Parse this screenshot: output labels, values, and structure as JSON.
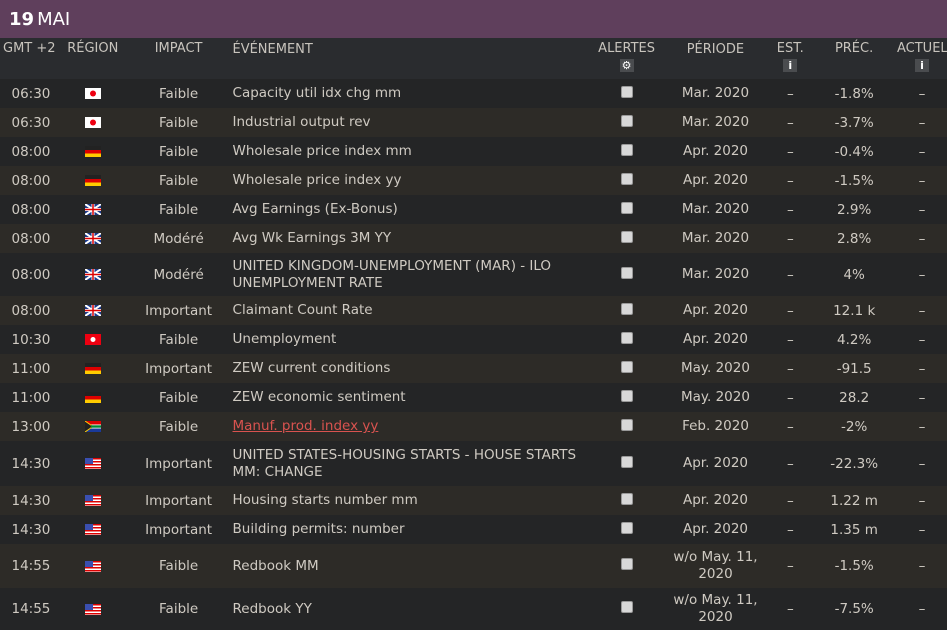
{
  "header": {
    "day": "19",
    "month": "MAI"
  },
  "columns": {
    "time": "GMT +2",
    "region": "RÉGION",
    "impact": "IMPACT",
    "event": "ÉVÉNEMENT",
    "alerts": "ALERTES",
    "period": "PÉRIODE",
    "est": "EST.",
    "prev": "PRÉC.",
    "actual": "ACTUEL",
    "info": "i",
    "gear": "⚙"
  },
  "rows": [
    {
      "time": "06:30",
      "region": "jp",
      "impact": "Faible",
      "event": "Capacity util idx chg mm",
      "period": "Mar. 2020",
      "est": "–",
      "prev": "-1.8%",
      "actual": "–"
    },
    {
      "time": "06:30",
      "region": "jp",
      "impact": "Faible",
      "event": "Industrial output rev",
      "period": "Mar. 2020",
      "est": "–",
      "prev": "-3.7%",
      "actual": "–"
    },
    {
      "time": "08:00",
      "region": "de",
      "impact": "Faible",
      "event": "Wholesale price index mm",
      "period": "Apr. 2020",
      "est": "–",
      "prev": "-0.4%",
      "actual": "–"
    },
    {
      "time": "08:00",
      "region": "de",
      "impact": "Faible",
      "event": "Wholesale price index yy",
      "period": "Apr. 2020",
      "est": "–",
      "prev": "-1.5%",
      "actual": "–"
    },
    {
      "time": "08:00",
      "region": "gb",
      "impact": "Faible",
      "event": "Avg Earnings (Ex-Bonus)",
      "period": "Mar. 2020",
      "est": "–",
      "prev": "2.9%",
      "actual": "–"
    },
    {
      "time": "08:00",
      "region": "gb",
      "impact": "Modéré",
      "event": "Avg Wk Earnings 3M YY",
      "period": "Mar. 2020",
      "est": "–",
      "prev": "2.8%",
      "actual": "–"
    },
    {
      "time": "08:00",
      "region": "gb",
      "impact": "Modéré",
      "event": "UNITED KINGDOM-UNEMPLOYMENT (MAR) - ILO UNEMPLOYMENT RATE",
      "period": "Mar. 2020",
      "est": "–",
      "prev": "4%",
      "actual": "–"
    },
    {
      "time": "08:00",
      "region": "gb",
      "impact": "Important",
      "event": "Claimant Count Rate",
      "period": "Apr. 2020",
      "est": "–",
      "prev": "12.1 k",
      "actual": "–"
    },
    {
      "time": "10:30",
      "region": "hk",
      "impact": "Faible",
      "event": "Unemployment",
      "period": "Apr. 2020",
      "est": "–",
      "prev": "4.2%",
      "actual": "–"
    },
    {
      "time": "11:00",
      "region": "de",
      "impact": "Important",
      "event": "ZEW current conditions",
      "period": "May. 2020",
      "est": "–",
      "prev": "-91.5",
      "actual": "–"
    },
    {
      "time": "11:00",
      "region": "de",
      "impact": "Faible",
      "event": "ZEW economic sentiment",
      "period": "May. 2020",
      "est": "–",
      "prev": "28.2",
      "actual": "–"
    },
    {
      "time": "13:00",
      "region": "za",
      "impact": "Faible",
      "event": "Manuf. prod. index yy",
      "link": true,
      "period": "Feb. 2020",
      "est": "–",
      "prev": "-2%",
      "actual": "–"
    },
    {
      "time": "14:30",
      "region": "us",
      "impact": "Important",
      "event": "UNITED STATES-HOUSING STARTS - HOUSE STARTS MM: CHANGE",
      "period": "Apr. 2020",
      "est": "–",
      "prev": "-22.3%",
      "actual": "–"
    },
    {
      "time": "14:30",
      "region": "us",
      "impact": "Important",
      "event": "Housing starts number mm",
      "period": "Apr. 2020",
      "est": "–",
      "prev": "1.22 m",
      "actual": "–"
    },
    {
      "time": "14:30",
      "region": "us",
      "impact": "Important",
      "event": "Building permits: number",
      "period": "Apr. 2020",
      "est": "–",
      "prev": "1.35 m",
      "actual": "–"
    },
    {
      "time": "14:55",
      "region": "us",
      "impact": "Faible",
      "event": "Redbook MM",
      "period": "w/o May. 11, 2020",
      "est": "–",
      "prev": "-1.5%",
      "actual": "–"
    },
    {
      "time": "14:55",
      "region": "us",
      "impact": "Faible",
      "event": "Redbook YY",
      "period": "w/o May. 11, 2020",
      "est": "–",
      "prev": "-7.5%",
      "actual": "–"
    }
  ]
}
